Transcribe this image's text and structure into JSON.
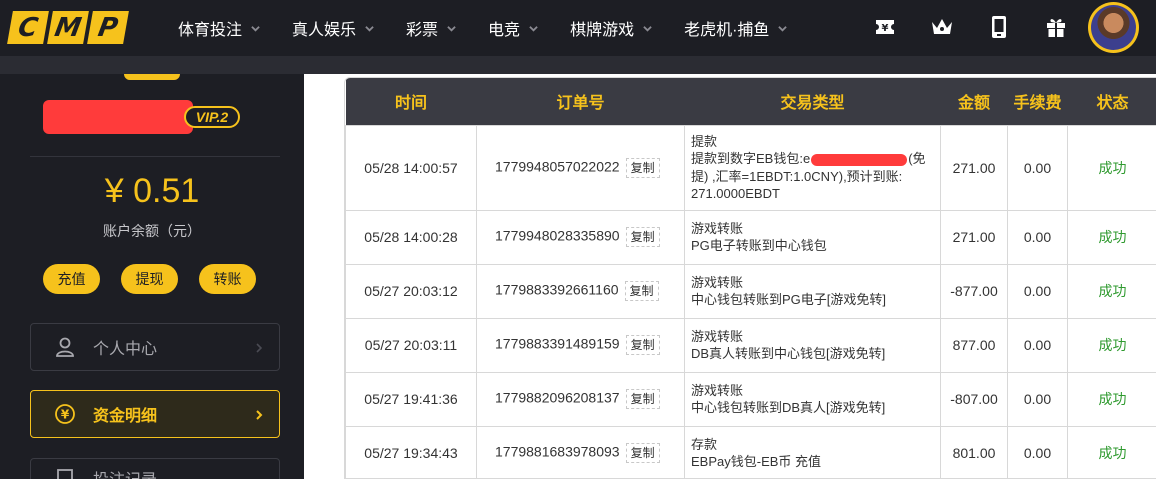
{
  "brand": {
    "logo_letters": [
      "C",
      "M",
      "P"
    ],
    "accent": "#f6c21c",
    "bg_dark": "#1d1e24"
  },
  "nav": {
    "items": [
      {
        "label": "体育投注"
      },
      {
        "label": "真人娱乐"
      },
      {
        "label": "彩票"
      },
      {
        "label": "电竞"
      },
      {
        "label": "棋牌游戏"
      },
      {
        "label": "老虎机·捕鱼"
      }
    ],
    "icons": [
      "ticket-icon",
      "crown-icon",
      "mobile-icon",
      "gift-icon"
    ]
  },
  "sidebar": {
    "vip_label": "VIP.2",
    "balance": "¥ 0.51",
    "balance_label": "账户余额（元）",
    "actions": {
      "deposit": "充值",
      "withdraw": "提现",
      "transfer": "转账"
    },
    "menu": [
      {
        "label": "个人中心",
        "icon": "user-icon"
      },
      {
        "label": "资金明细",
        "icon": "yen-coin-icon"
      },
      {
        "label": "投注记录",
        "icon": "document-icon"
      }
    ]
  },
  "table": {
    "headers": {
      "time": "时间",
      "order": "订单号",
      "type": "交易类型",
      "amount": "金额",
      "fee": "手续费",
      "status": "状态"
    },
    "copy_label": "复制",
    "rows": [
      {
        "time": "05/28 14:00:57",
        "order": "1779948057022022",
        "type_title": "提款",
        "type_l1_a": "提款到数字EB钱包:e",
        "type_l1_b": "(免",
        "type_l2": "提) ,汇率=1EBDT:1.0CNY),预计到账:",
        "type_l3": "271.0000EBDT",
        "amount": "271.00",
        "fee": "0.00",
        "status": "成功"
      },
      {
        "time": "05/28 14:00:28",
        "order": "1779948028335890",
        "type_title": "游戏转账",
        "type_desc": "PG电子转账到中心钱包",
        "amount": "271.00",
        "fee": "0.00",
        "status": "成功"
      },
      {
        "time": "05/27 20:03:12",
        "order": "1779883392661160",
        "type_title": "游戏转账",
        "type_desc": "中心钱包转账到PG电子[游戏免转]",
        "amount": "-877.00",
        "fee": "0.00",
        "status": "成功"
      },
      {
        "time": "05/27 20:03:11",
        "order": "1779883391489159",
        "type_title": "游戏转账",
        "type_desc": "DB真人转账到中心钱包[游戏免转]",
        "amount": "877.00",
        "fee": "0.00",
        "status": "成功"
      },
      {
        "time": "05/27 19:41:36",
        "order": "1779882096208137",
        "type_title": "游戏转账",
        "type_desc": "中心钱包转账到DB真人[游戏免转]",
        "amount": "-807.00",
        "fee": "0.00",
        "status": "成功"
      },
      {
        "time": "05/27 19:34:43",
        "order": "1779881683978093",
        "type_title": "存款",
        "type_desc": "EBPay钱包-EB币 充值",
        "amount": "801.00",
        "fee": "0.00",
        "status": "成功"
      }
    ]
  }
}
